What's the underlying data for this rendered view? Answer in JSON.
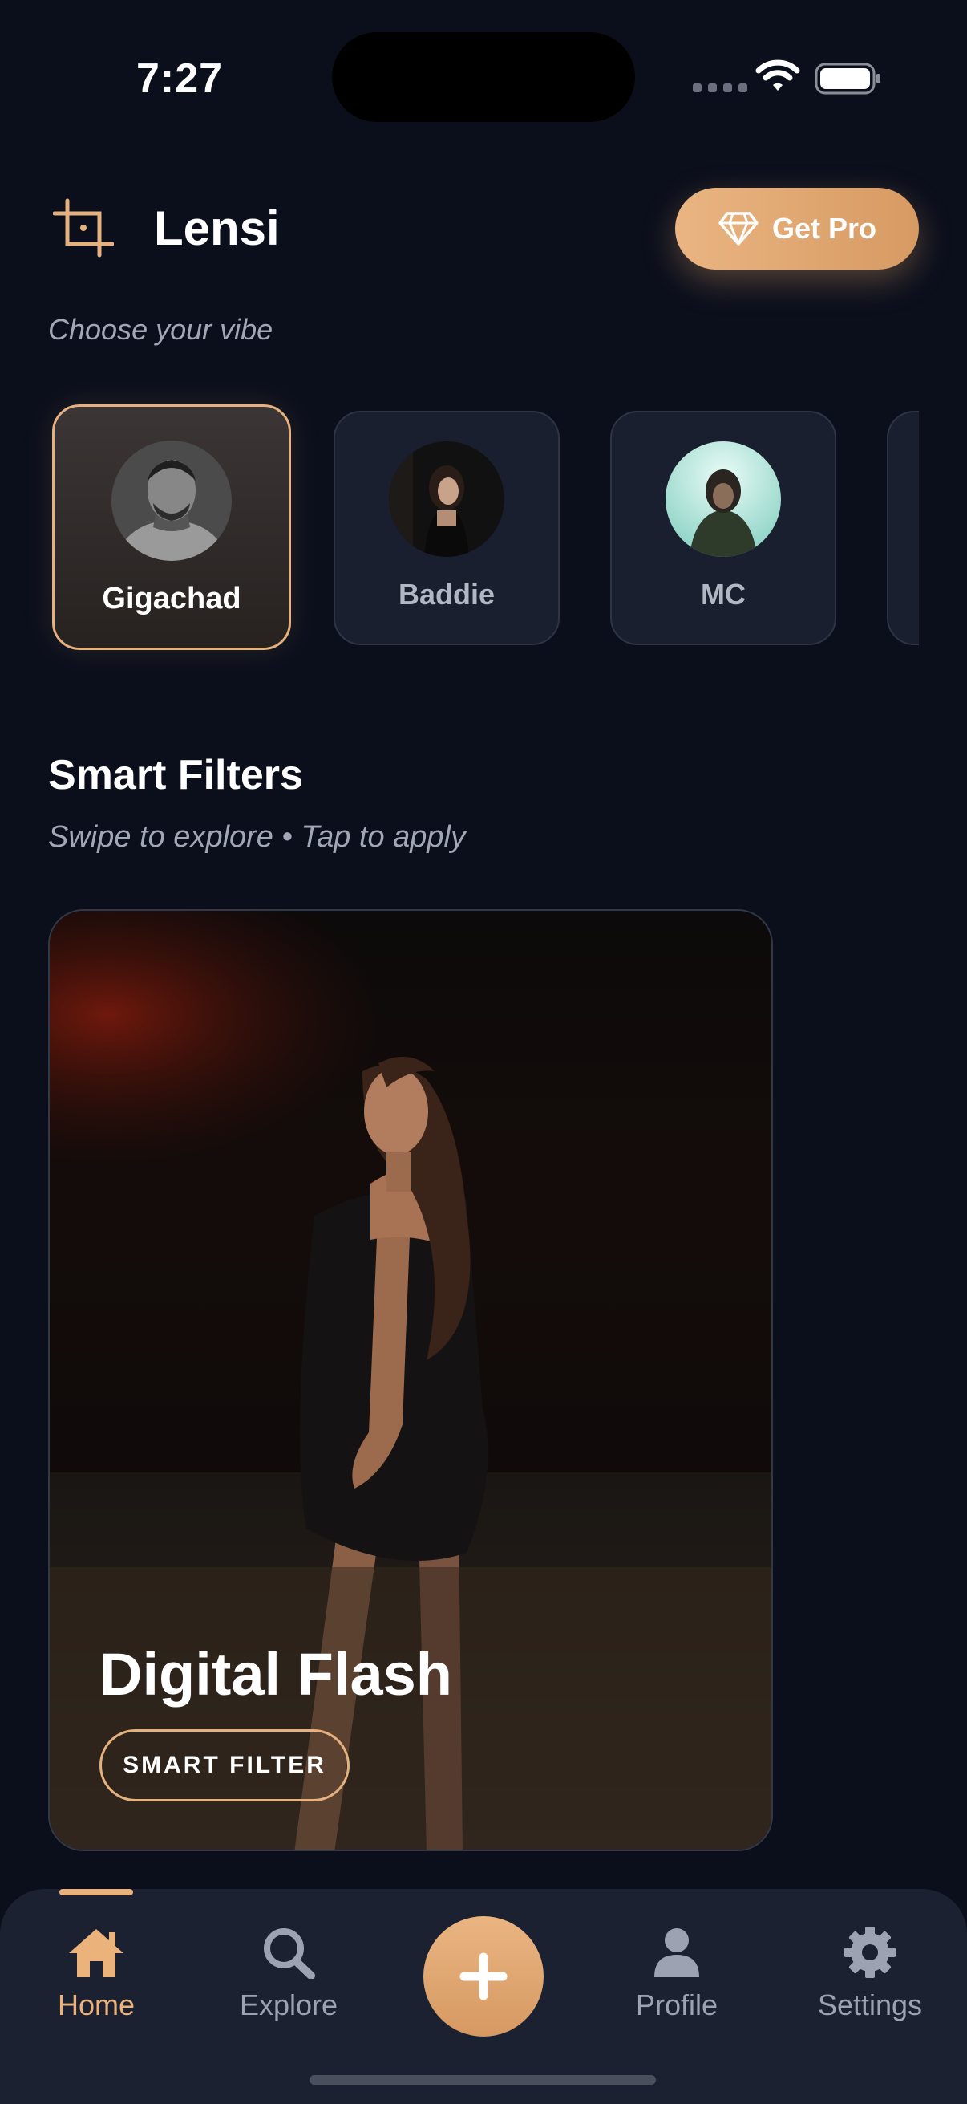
{
  "status_bar": {
    "time": "7:27"
  },
  "header": {
    "brand": "Lensi",
    "pro_button_label": "Get Pro",
    "subtitle": "Choose your vibe"
  },
  "vibes": [
    {
      "label": "Gigachad",
      "selected": true
    },
    {
      "label": "Baddie",
      "selected": false
    },
    {
      "label": "MC",
      "selected": false
    }
  ],
  "smart_filters": {
    "title": "Smart Filters",
    "subtitle": "Swipe to explore • Tap to apply",
    "card": {
      "name": "Digital Flash",
      "tag": "SMART FILTER"
    }
  },
  "bottom_nav": {
    "items": [
      {
        "label": "Home",
        "icon": "home-icon",
        "active": true
      },
      {
        "label": "Explore",
        "icon": "search-icon",
        "active": false
      },
      {
        "label": "Profile",
        "icon": "person-icon",
        "active": false
      },
      {
        "label": "Settings",
        "icon": "gear-icon",
        "active": false
      }
    ],
    "add_button_icon": "plus-icon"
  },
  "colors": {
    "accent": "#e4b17f",
    "background": "#0b0f1c",
    "card": "#1a1f2f"
  }
}
